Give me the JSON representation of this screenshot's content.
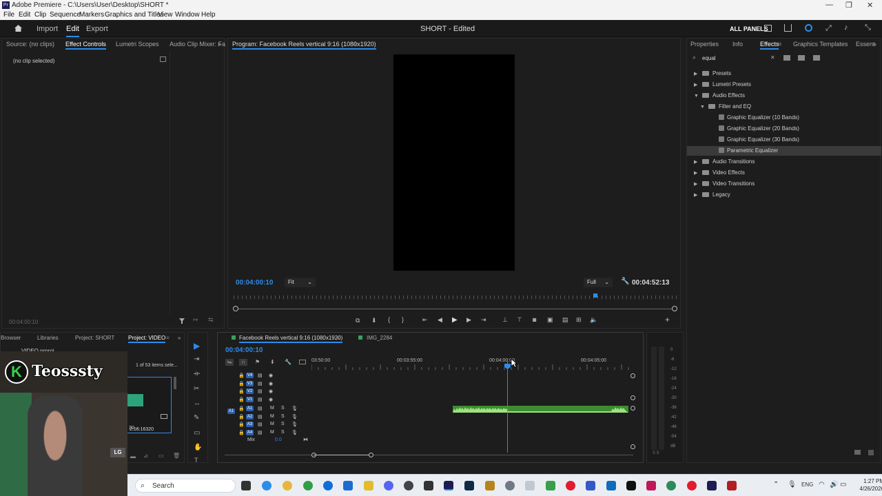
{
  "window": {
    "title": "Adobe Premiere - C:\\Users\\User\\Desktop\\SHORT *",
    "app_badge": "Pr",
    "minimize": "—",
    "restore": "❐",
    "close": "✕"
  },
  "menu": [
    "File",
    "Edit",
    "Clip",
    "Sequence",
    "Markers",
    "Graphics and Titles",
    "View",
    "Window",
    "Help"
  ],
  "appbar": {
    "workspaces": [
      "Import",
      "Edit",
      "Export"
    ],
    "active_workspace": "Edit",
    "project_title": "SHORT - Edited",
    "all_panels": "ALL PANELS"
  },
  "source_panel": {
    "tabs": [
      "Source: (no clips)",
      "Effect Controls",
      "Lumetri Scopes",
      "Audio Clip Mixer: Fa"
    ],
    "no_clip": "(no clip selected)",
    "timecode": "00:04:00:10"
  },
  "program": {
    "title": "Program: Facebook Reels vertical 9:16 (1080x1920)",
    "timecode": "00:04:00:10",
    "fit": "Fit",
    "quality": "Full",
    "duration": "00:04:52:13"
  },
  "effects_panel": {
    "tabs": [
      "Properties",
      "Info",
      "Effects",
      "Graphics Templates",
      "Essent"
    ],
    "search": "equal",
    "tree": [
      {
        "label": "Presets",
        "kind": "folder",
        "level": 0
      },
      {
        "label": "Lumetri Presets",
        "kind": "folder",
        "level": 0
      },
      {
        "label": "Audio Effects",
        "kind": "folder",
        "level": 0,
        "open": true
      },
      {
        "label": "Filter and EQ",
        "kind": "folder",
        "level": 1,
        "open": true
      },
      {
        "label": "Graphic Equalizer (10 Bands)",
        "kind": "effect",
        "level": 2
      },
      {
        "label": "Graphic Equalizer (20 Bands)",
        "kind": "effect",
        "level": 2
      },
      {
        "label": "Graphic Equalizer (30 Bands)",
        "kind": "effect",
        "level": 2
      },
      {
        "label": "Parametric Equalizer",
        "kind": "effect",
        "level": 2,
        "selected": true
      },
      {
        "label": "Audio Transitions",
        "kind": "folder",
        "level": 0
      },
      {
        "label": "Video Effects",
        "kind": "folder",
        "level": 0
      },
      {
        "label": "Video Transitions",
        "kind": "folder",
        "level": 0
      },
      {
        "label": "Legacy",
        "kind": "folder",
        "level": 0
      }
    ]
  },
  "project_panel": {
    "tabs": [
      "Browser",
      "Libraries",
      "Project: SHORT",
      "Project: VIDEO"
    ],
    "file": "VIDEO.prproj",
    "items_info": "1 of 53 items sele...",
    "clip_duration": "2:16:16320",
    "clip_name": "20..."
  },
  "webcam_overlay": {
    "badge": "K",
    "channel": "Teosssty"
  },
  "timeline": {
    "tabs": [
      "Facebook Reels vertical 9:16 (1080x1920)",
      "IMG_2284"
    ],
    "timecode": "00:04:00:10",
    "ruler": [
      "03:50:00",
      "00:03:55:00",
      "00:04:00:00",
      "00:04:05:00"
    ],
    "video_tracks": [
      "V4",
      "V3",
      "V2",
      "V1"
    ],
    "audio_tracks": [
      "A1",
      "A2",
      "A3",
      "A4"
    ],
    "source_patch": "A1",
    "mix_label": "Mix",
    "mix_value": "0.0",
    "meter_ticks": [
      "0",
      "-6",
      "-12",
      "-18",
      "-24",
      "-30",
      "-36",
      "-42",
      "-48",
      "-54",
      "dB"
    ],
    "meter_footer": "S  S"
  },
  "taskbar": {
    "search": "Search",
    "lang": "ENG",
    "time": "1:27 PM",
    "date": "4/26/2026"
  }
}
